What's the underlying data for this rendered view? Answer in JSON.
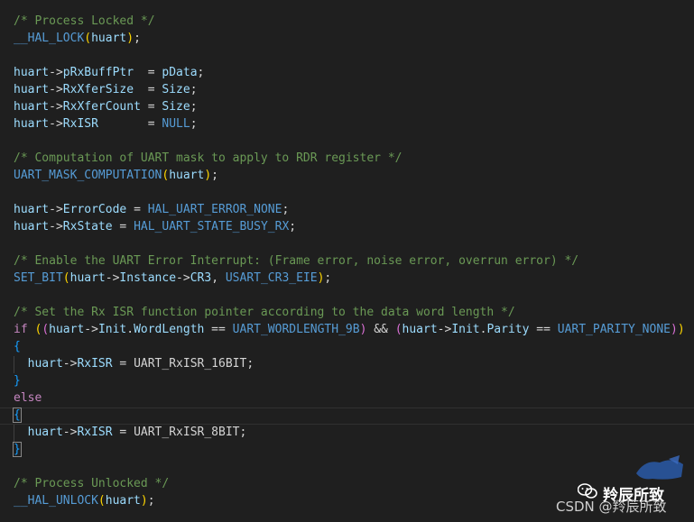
{
  "code": {
    "l1_comment": "/* Process Locked */",
    "l2_macro": "__HAL_LOCK",
    "l2_arg": "huart",
    "l4_var": "huart",
    "l4_field": "pRxBuffPtr",
    "l4_val": "pData",
    "l5_var": "huart",
    "l5_field": "RxXferSize",
    "l5_val": "Size",
    "l6_var": "huart",
    "l6_field": "RxXferCount",
    "l6_val": "Size",
    "l7_var": "huart",
    "l7_field": "RxISR",
    "l7_val": "NULL",
    "l9_comment": "/* Computation of UART mask to apply to RDR register */",
    "l10_macro": "UART_MASK_COMPUTATION",
    "l10_arg": "huart",
    "l12_var": "huart",
    "l12_field": "ErrorCode",
    "l12_val": "HAL_UART_ERROR_NONE",
    "l13_var": "huart",
    "l13_field": "RxState",
    "l13_val": "HAL_UART_STATE_BUSY_RX",
    "l15_comment": "/* Enable the UART Error Interrupt: (Frame error, noise error, overrun error) */",
    "l16_macro": "SET_BIT",
    "l16_var": "huart",
    "l16_field": "Instance",
    "l16_field2": "CR3",
    "l16_val": "USART_CR3_EIE",
    "l18_comment": "/* Set the Rx ISR function pointer according to the data word length */",
    "l19_kw": "if",
    "l19_var1": "huart",
    "l19_f1": "Init",
    "l19_f2": "WordLength",
    "l19_c1": "UART_WORDLENGTH_9B",
    "l19_var2": "huart",
    "l19_f3": "Init",
    "l19_f4": "Parity",
    "l19_c2": "UART_PARITY_NONE",
    "l21_var": "huart",
    "l21_field": "RxISR",
    "l21_val": "UART_RxISR_16BIT",
    "l23_kw": "else",
    "l25_var": "huart",
    "l25_field": "RxISR",
    "l25_val": "UART_RxISR_8BIT",
    "l28_comment": "/* Process Unlocked */",
    "l29_macro": "__HAL_UNLOCK",
    "l29_arg": "huart"
  },
  "watermark": {
    "line1": "羚辰所致",
    "line2": "CSDN @羚辰所致"
  },
  "colors": {
    "background": "#1f1f1f",
    "comment": "#6a9955",
    "macro": "#569cd6",
    "variable": "#9cdcfe",
    "keyword": "#c586c0",
    "text": "#d4d4d4"
  }
}
